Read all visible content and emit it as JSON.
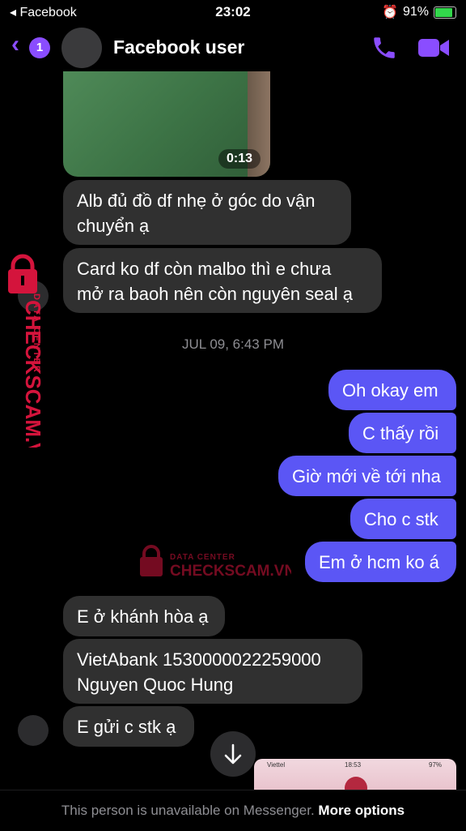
{
  "status_bar": {
    "back_app": "◂ Facebook",
    "time": "23:02",
    "battery": "91%"
  },
  "header": {
    "badge_count": "1",
    "title": "Facebook user"
  },
  "video": {
    "duration": "0:13"
  },
  "messages_in_1": [
    "Alb đủ đồ df nhẹ ở góc do vận",
    "chuyển ạ",
    "Card ko df còn malbo thì e chưa",
    "mở ra baoh nên còn nguyên seal ạ"
  ],
  "date_separator": "JUL 09, 6:43 PM",
  "messages_out": [
    "Oh okay em",
    "C thấy rồi",
    "Giờ mới về tới nha",
    "Cho c stk",
    "Em ở hcm ko á"
  ],
  "messages_in_2": [
    "E ở khánh hòa ạ",
    "VietAbank 1530000022259000",
    "Nguyen Quoc Hung",
    "E gửi c stk ạ"
  ],
  "watermark": {
    "line1": "DATA CENTER",
    "line2": "CHECKSCAM.VN"
  },
  "preview": {
    "carrier": "Viettel",
    "time": "18:53",
    "battery": "97%"
  },
  "footer": {
    "message": "This person is unavailable on Messenger.",
    "link": "More options"
  },
  "colors": {
    "accent": "#8a4dff",
    "outgoing_bubble": "#5b56f5",
    "incoming_bubble": "#303030",
    "watermark": "#d4143c"
  }
}
